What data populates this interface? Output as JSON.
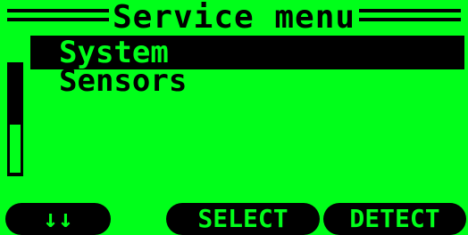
{
  "screen": {
    "title": "Service menu",
    "menu": {
      "items": [
        {
          "label": "System",
          "selected": true
        },
        {
          "label": "Sensors",
          "selected": false
        }
      ]
    },
    "scrollbar": {
      "position": 0.6
    },
    "softkeys": {
      "left": "↓↓",
      "center": "SELECT",
      "right": "DETECT"
    }
  },
  "colors": {
    "background": "#00ff1a",
    "foreground": "#000000"
  }
}
